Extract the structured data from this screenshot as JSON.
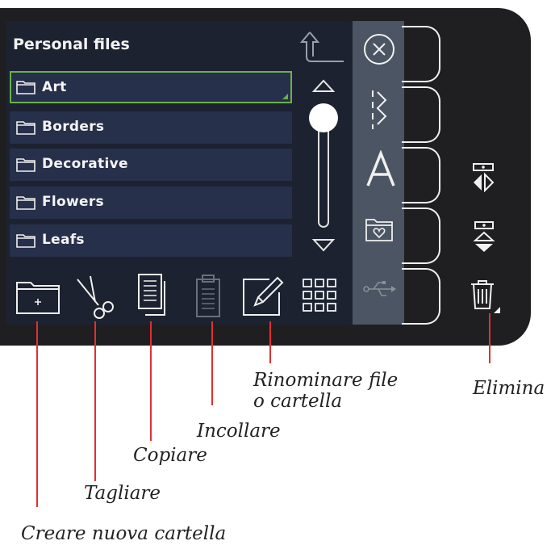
{
  "header": {
    "title": "Personal files"
  },
  "files": [
    {
      "name": "Art",
      "selected": true
    },
    {
      "name": "Borders",
      "selected": false
    },
    {
      "name": "Decorative",
      "selected": false
    },
    {
      "name": "Flowers",
      "selected": false
    },
    {
      "name": "Leafs",
      "selected": false
    }
  ],
  "annotations": {
    "create": "Creare nuova cartella",
    "cut": "Tagliare",
    "copy": "Copiare",
    "paste": "Incollare",
    "rename_1": "Rinominare file",
    "rename_2": "o cartella",
    "delete": "Elimina"
  },
  "colors": {
    "accent": "#6ab04c",
    "callout_line": "#e03030",
    "panel": "#1c2230",
    "row": "#27304a"
  }
}
